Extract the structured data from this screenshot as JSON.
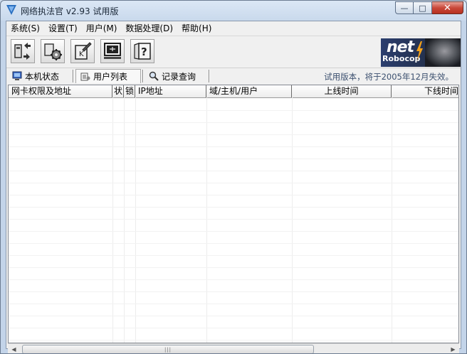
{
  "window": {
    "title": "网络执法官 v2.93 试用版",
    "buttons": {
      "minimize": "—",
      "maximize": "□",
      "close": "✕"
    }
  },
  "menu": {
    "items": [
      "系统(S)",
      "设置(T)",
      "用户(M)",
      "数据处理(D)",
      "帮助(H)"
    ]
  },
  "toolbar": {
    "buttons": [
      "monitor-toggle-icon",
      "settings-gear-icon",
      "user-key-icon",
      "screen-display-icon",
      "help-question-icon"
    ]
  },
  "logo": {
    "line1": "net",
    "line2": "Robocop"
  },
  "tabs": {
    "items": [
      {
        "label": "本机状态",
        "icon": "local-machine-icon"
      },
      {
        "label": "用户列表",
        "icon": "user-list-icon"
      },
      {
        "label": "记录查询",
        "icon": "record-search-icon"
      }
    ],
    "active_index": 1
  },
  "trial_note": "试用版本，将于2005年12月失效。",
  "grid": {
    "columns": [
      "网卡权限及地址",
      "状",
      "锁",
      "IP地址",
      "域/主机/用户",
      "上线时间",
      "下线时间"
    ],
    "rows": []
  },
  "colors": {
    "title_bg": "#dbe7f5",
    "close_btn": "#c9483a",
    "logo_bg": "#24314f",
    "trial_note": "#3b4f6e"
  }
}
